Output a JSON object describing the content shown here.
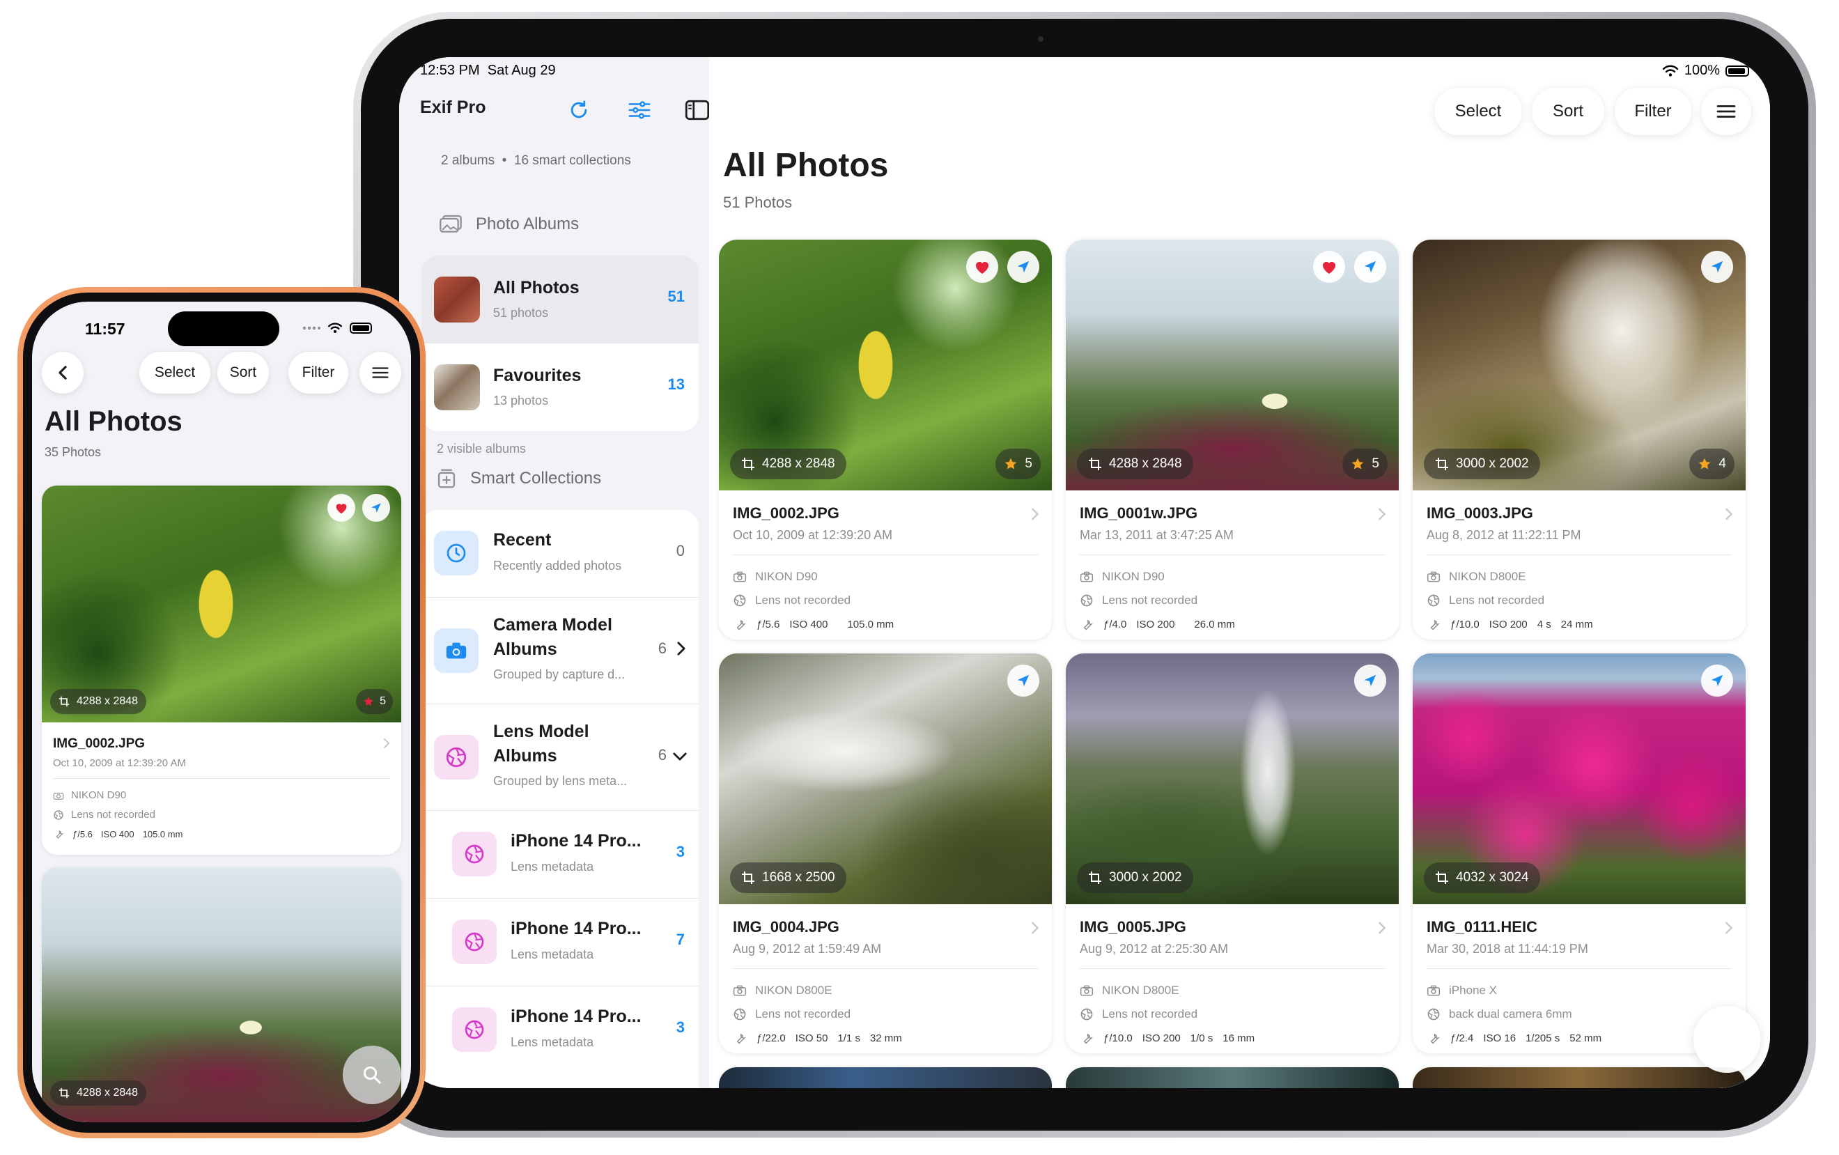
{
  "ipad": {
    "status": {
      "time": "12:53 PM",
      "date": "Sat Aug 29",
      "battery": "100%"
    },
    "sidebar": {
      "app_title": "Exif Pro",
      "albums_count": "2 albums",
      "collections_count": "16 smart collections",
      "separator": "•",
      "photo_albums_header": "Photo Albums",
      "albums": [
        {
          "name": "All Photos",
          "sub": "51 photos",
          "count": "51"
        },
        {
          "name": "Favourites",
          "sub": "13 photos",
          "count": "13"
        }
      ],
      "visible_albums": "2 visible albums",
      "smart_header": "Smart Collections",
      "smart": [
        {
          "name": "Recent",
          "sub": "Recently added photos",
          "count": "0"
        },
        {
          "name1": "Camera Model",
          "name2": "Albums",
          "sub": "Grouped by capture d...",
          "count": "6"
        },
        {
          "name1": "Lens Model",
          "name2": "Albums",
          "sub": "Grouped by lens meta...",
          "count": "6"
        },
        {
          "name": "iPhone 14 Pro...",
          "sub": "Lens metadata",
          "count": "3"
        },
        {
          "name": "iPhone 14 Pro...",
          "sub": "Lens metadata",
          "count": "7"
        },
        {
          "name": "iPhone 14 Pro...",
          "sub": "Lens metadata",
          "count": "3"
        }
      ]
    },
    "nav": {
      "select": "Select",
      "sort": "Sort",
      "filter": "Filter"
    },
    "main": {
      "title": "All Photos",
      "subtitle": "51 Photos"
    },
    "photos": [
      {
        "dims": "4288 x 2848",
        "rating": "5",
        "name": "IMG_0002.JPG",
        "date": "Oct 10, 2009 at 12:39:20 AM",
        "camera": "NIKON D90",
        "lens": "Lens not recorded",
        "aperture": "ƒ/5.6",
        "iso": "ISO 400",
        "shutter": "",
        "focal": "105.0 mm"
      },
      {
        "dims": "4288 x 2848",
        "rating": "5",
        "name": "IMG_0001w.JPG",
        "date": "Mar 13, 2011 at 3:47:25 AM",
        "camera": "NIKON D90",
        "lens": "Lens not recorded",
        "aperture": "ƒ/4.0",
        "iso": "ISO 200",
        "shutter": "",
        "focal": "26.0 mm"
      },
      {
        "dims": "3000 x 2002",
        "rating": "4",
        "name": "IMG_0003.JPG",
        "date": "Aug 8, 2012 at 11:22:11 PM",
        "camera": "NIKON D800E",
        "lens": "Lens not recorded",
        "aperture": "ƒ/10.0",
        "iso": "ISO 200",
        "shutter": "4 s",
        "focal": "24 mm"
      },
      {
        "dims": "1668 x 2500",
        "rating": "",
        "name": "IMG_0004.JPG",
        "date": "Aug 9, 2012 at 1:59:49 AM",
        "camera": "NIKON D800E",
        "lens": "Lens not recorded",
        "aperture": "ƒ/22.0",
        "iso": "ISO 50",
        "shutter": "1/1 s",
        "focal": "32 mm"
      },
      {
        "dims": "3000 x 2002",
        "rating": "",
        "name": "IMG_0005.JPG",
        "date": "Aug 9, 2012 at 2:25:30 AM",
        "camera": "NIKON D800E",
        "lens": "Lens not recorded",
        "aperture": "ƒ/10.0",
        "iso": "ISO 200",
        "shutter": "1/0 s",
        "focal": "16 mm"
      },
      {
        "dims": "4032 x 3024",
        "rating": "",
        "name": "IMG_0111.HEIC",
        "date": "Mar 30, 2018 at 11:44:19 PM",
        "camera": "iPhone X",
        "lens": "back dual camera 6mm",
        "aperture": "ƒ/2.4",
        "iso": "ISO 16",
        "shutter": "1/205 s",
        "focal": "52 mm"
      }
    ]
  },
  "iphone": {
    "time": "11:57",
    "nav": {
      "select": "Select",
      "sort": "Sort",
      "filter": "Filter"
    },
    "title": "All Photos",
    "subtitle": "35 Photos",
    "cards": [
      {
        "dims": "4288 x 2848",
        "rating": "5",
        "name": "IMG_0002.JPG",
        "date": "Oct 10, 2009 at 12:39:20 AM",
        "camera": "NIKON D90",
        "lens": "Lens not recorded",
        "aperture": "ƒ/5.6",
        "iso": "ISO 400",
        "focal": "105.0 mm"
      },
      {
        "dims": "4288 x 2848"
      }
    ]
  },
  "colors": {
    "accent_blue": "#1c8cf0",
    "heart_red": "#e5243b",
    "star_orange": "#f5a623",
    "phone_orange": "#e9833f"
  }
}
